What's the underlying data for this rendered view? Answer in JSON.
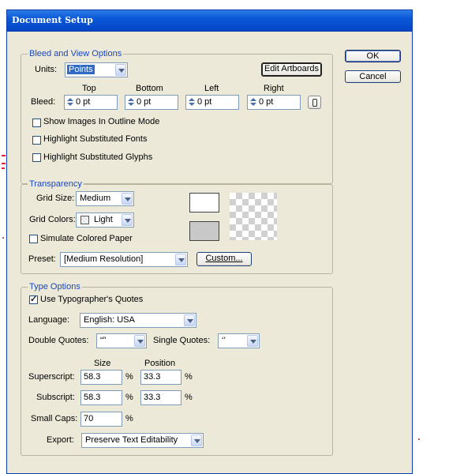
{
  "dialog": {
    "title": "Document Setup",
    "ok_label": "OK",
    "cancel_label": "Cancel"
  },
  "bleed_view": {
    "legend": "Bleed and View Options",
    "units_label": "Units:",
    "units_value": "Points",
    "edit_artboards_label": "Edit Artboards",
    "bleed_label": "Bleed:",
    "headers": {
      "top": "Top",
      "bottom": "Bottom",
      "left": "Left",
      "right": "Right"
    },
    "values": {
      "top": "0 pt",
      "bottom": "0 pt",
      "left": "0 pt",
      "right": "0 pt"
    },
    "show_images_outline": {
      "label": "Show Images In Outline Mode",
      "checked": false
    },
    "highlight_fonts": {
      "label": "Highlight Substituted Fonts",
      "checked": false
    },
    "highlight_glyphs": {
      "label": "Highlight Substituted Glyphs",
      "checked": false
    }
  },
  "transparency": {
    "legend": "Transparency",
    "grid_size_label": "Grid Size:",
    "grid_size_value": "Medium",
    "grid_colors_label": "Grid Colors:",
    "grid_colors_value": "Light",
    "simulate_paper": {
      "label": "Simulate Colored Paper",
      "checked": false
    },
    "preset_label": "Preset:",
    "preset_value": "[Medium Resolution]",
    "custom_label": "Custom...",
    "swatch_top_color": "#ffffff",
    "swatch_bottom_color": "#c8c8c8"
  },
  "type_options": {
    "legend": "Type Options",
    "typographers_quotes": {
      "label": "Use Typographer's Quotes",
      "checked": true
    },
    "language_label": "Language:",
    "language_value": "English: USA",
    "double_quotes_label": "Double Quotes:",
    "double_quotes_value": "“”",
    "single_quotes_label": "Single Quotes:",
    "single_quotes_value": "‘’",
    "size_header": "Size",
    "position_header": "Position",
    "superscript_label": "Superscript:",
    "superscript_size": "58.3",
    "superscript_position": "33.3",
    "subscript_label": "Subscript:",
    "subscript_size": "58.3",
    "subscript_position": "33.3",
    "small_caps_label": "Small Caps:",
    "small_caps_value": "70",
    "percent": "%",
    "export_label": "Export:",
    "export_value": "Preserve Text Editability"
  }
}
